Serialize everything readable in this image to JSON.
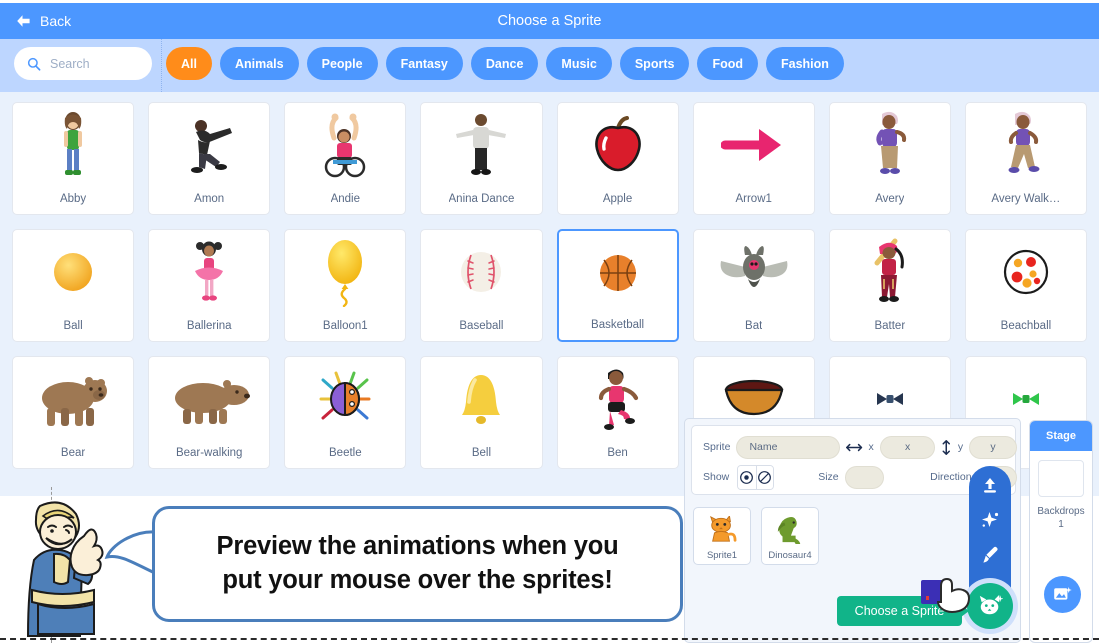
{
  "header": {
    "back_label": "Back",
    "title": "Choose a Sprite",
    "back_icon": "arrow-left-icon",
    "bg_color": "#4C97FF"
  },
  "filter_bar": {
    "search": {
      "placeholder": "Search",
      "value": "",
      "icon": "search-icon"
    },
    "categories": [
      {
        "label": "All",
        "active": true
      },
      {
        "label": "Animals",
        "active": false
      },
      {
        "label": "People",
        "active": false
      },
      {
        "label": "Fantasy",
        "active": false
      },
      {
        "label": "Dance",
        "active": false
      },
      {
        "label": "Music",
        "active": false
      },
      {
        "label": "Sports",
        "active": false
      },
      {
        "label": "Food",
        "active": false
      },
      {
        "label": "Fashion",
        "active": false
      }
    ],
    "active_color": "#FF8C1A",
    "pill_color": "#4C97FF",
    "bg_color": "#BDD6FF"
  },
  "sprite_grid": {
    "selected": "Basketball",
    "tiles": [
      {
        "label": "Abby",
        "art": "girl-green-shirt"
      },
      {
        "label": "Amon",
        "art": "man-dancing"
      },
      {
        "label": "Andie",
        "art": "wheelchair-dancer"
      },
      {
        "label": "Anina Dance",
        "art": "anina-dancer"
      },
      {
        "label": "Apple",
        "art": "apple"
      },
      {
        "label": "Arrow1",
        "art": "arrow-right"
      },
      {
        "label": "Avery",
        "art": "avery-standing"
      },
      {
        "label": "Avery Walk…",
        "art": "avery-walking"
      },
      {
        "label": "Ball",
        "art": "ball-yellow"
      },
      {
        "label": "Ballerina",
        "art": "ballerina"
      },
      {
        "label": "Balloon1",
        "art": "balloon"
      },
      {
        "label": "Baseball",
        "art": "baseball"
      },
      {
        "label": "Basketball",
        "art": "basketball"
      },
      {
        "label": "Bat",
        "art": "bat"
      },
      {
        "label": "Batter",
        "art": "batter"
      },
      {
        "label": "Beachball",
        "art": "beachball"
      },
      {
        "label": "Bear",
        "art": "bear"
      },
      {
        "label": "Bear-walking",
        "art": "bear-walking"
      },
      {
        "label": "Beetle",
        "art": "beetle"
      },
      {
        "label": "Bell",
        "art": "bell"
      },
      {
        "label": "Ben",
        "art": "ben"
      },
      {
        "label": "",
        "art": "bowl"
      },
      {
        "label": "",
        "art": "bowtie-navy"
      },
      {
        "label": "",
        "art": "bowtie-green"
      }
    ]
  },
  "sprite_panel": {
    "sprite_label": "Sprite",
    "name_placeholder": "Name",
    "x_label": "x",
    "x_placeholder": "x",
    "y_label": "y",
    "y_placeholder": "y",
    "show_label": "Show",
    "size_label": "Size",
    "size_value": "",
    "direction_label": "Direction",
    "direction_value": "",
    "show_icon": "eye-icon",
    "hide_icon": "eye-slash-icon",
    "x_axis_icon": "arrows-horizontal-icon",
    "y_axis_icon": "arrows-vertical-icon",
    "sprites": [
      {
        "name": "Sprite1",
        "art": "scratch-cat"
      },
      {
        "name": "Dinosaur4",
        "art": "dinosaur"
      }
    ]
  },
  "toolbar": {
    "icons": [
      {
        "name": "upload-sprite-icon"
      },
      {
        "name": "surprise-sprite-icon"
      },
      {
        "name": "paint-sprite-icon"
      },
      {
        "name": "search-sprite-icon"
      }
    ],
    "fab_icon": "choose-sprite-cat-icon",
    "fab_color": "#11B489",
    "tooltip": "Choose a Sprite"
  },
  "stage_panel": {
    "title": "Stage",
    "backdrops_label": "Backdrops",
    "backdrops_count": "1",
    "add_backdrop_icon": "add-backdrop-icon",
    "accent_color": "#4C97FF"
  },
  "callout": {
    "line1": "Preview the animations when you",
    "line2": "put your mouse over the sprites!",
    "border_color": "#4A7EBB"
  },
  "cursor": {
    "icon": "hand-pointer-icon"
  }
}
